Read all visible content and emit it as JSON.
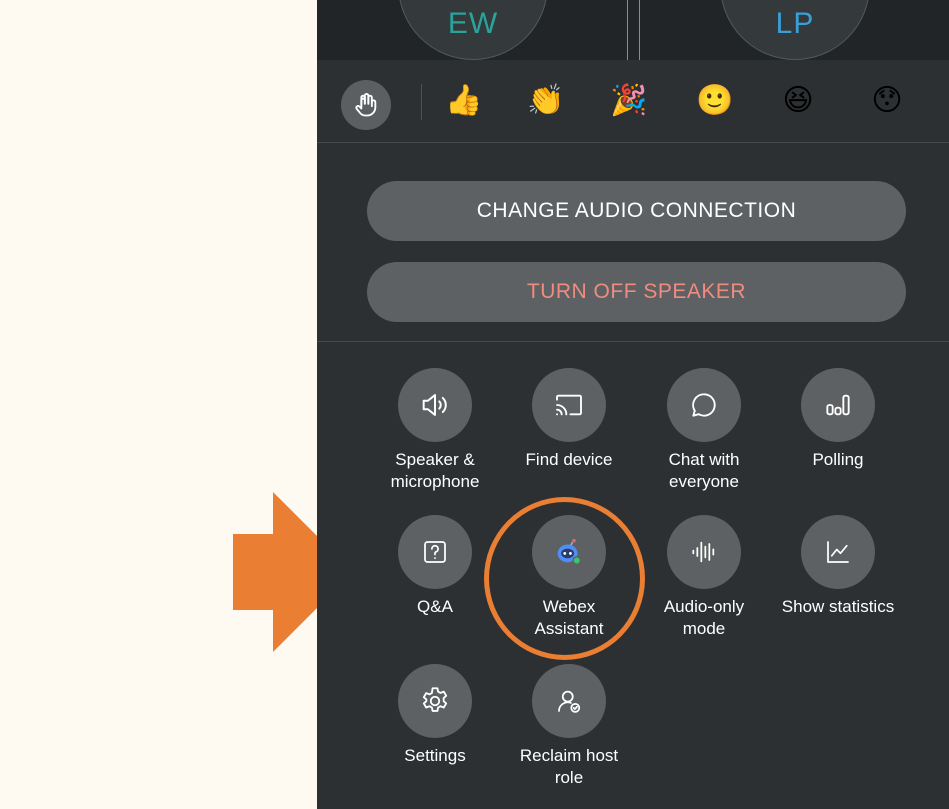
{
  "colors": {
    "accent_arrow": "#ea7e33",
    "panel_background": "#2d3032",
    "button_background": "#5e6163",
    "danger_text": "#f08b7e",
    "assistant_icon": "#4f8df7"
  },
  "participants": [
    {
      "initials": "EW",
      "color": "#2aa39a"
    },
    {
      "initials": "LP",
      "color": "#3a9fd6"
    }
  ],
  "reactions": [
    {
      "name": "raise-hand-icon",
      "glyph": "✋"
    },
    {
      "name": "thumbs-up-icon",
      "glyph": "👍"
    },
    {
      "name": "clapping-hands-icon",
      "glyph": "👏"
    },
    {
      "name": "party-popper-icon",
      "glyph": "🎉"
    },
    {
      "name": "smile-icon",
      "glyph": "🙂"
    },
    {
      "name": "laughing-icon",
      "glyph": "😆"
    },
    {
      "name": "surprised-icon",
      "glyph": "😯"
    }
  ],
  "buttons": {
    "change_audio": "CHANGE AUDIO CONNECTION",
    "turn_off_speaker": "TURN OFF SPEAKER"
  },
  "tools": [
    {
      "label": "Speaker &\nmicrophone",
      "icon": "speaker-icon"
    },
    {
      "label": "Find device",
      "icon": "cast-icon"
    },
    {
      "label": "Chat with\neveryone",
      "icon": "chat-bubble-icon"
    },
    {
      "label": "Polling",
      "icon": "poll-bars-icon"
    },
    {
      "label": "Q&A",
      "icon": "question-icon"
    },
    {
      "label": "Webex\nAssistant",
      "icon": "assistant-bot-icon"
    },
    {
      "label": "Audio-only\nmode",
      "icon": "audio-wave-icon"
    },
    {
      "label": "Show statistics",
      "icon": "statistics-chart-icon"
    },
    {
      "label": "Settings",
      "icon": "gear-icon"
    },
    {
      "label": "Reclaim host\nrole",
      "icon": "host-role-icon"
    }
  ]
}
